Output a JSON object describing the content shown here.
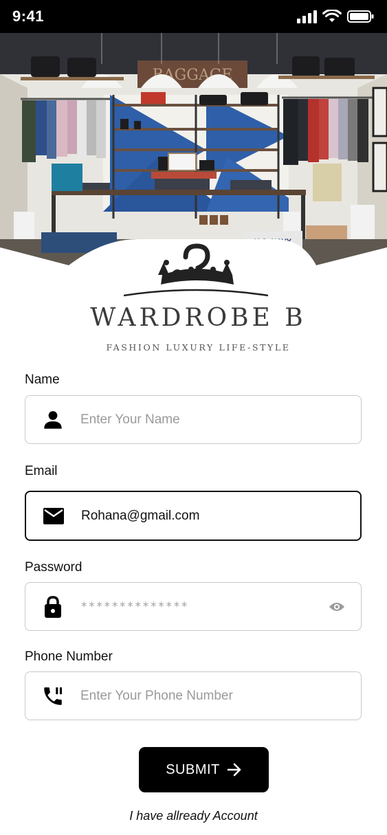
{
  "status_bar": {
    "time": "9:41"
  },
  "brand": {
    "title": "WARDROBE B",
    "tagline": "FASHION LUXURY LIFE-STYLE"
  },
  "hero": {
    "store_sign": "BAGGAGE",
    "box_label": "U.S. NAVY"
  },
  "form": {
    "name": {
      "label": "Name",
      "placeholder": "Enter Your Name",
      "value": ""
    },
    "email": {
      "label": "Email",
      "placeholder": "",
      "value": "Rohana@gmail.com"
    },
    "password": {
      "label": "Password",
      "masked_value": "**************"
    },
    "phone": {
      "label": "Phone Number",
      "placeholder": "Enter Your Phone Number",
      "value": ""
    }
  },
  "submit_label": "SUBMIT",
  "account_link": "I have allready Account",
  "colors": {
    "primary": "#000000",
    "field_border": "#c9c9c9",
    "placeholder": "#9a9a9a"
  }
}
